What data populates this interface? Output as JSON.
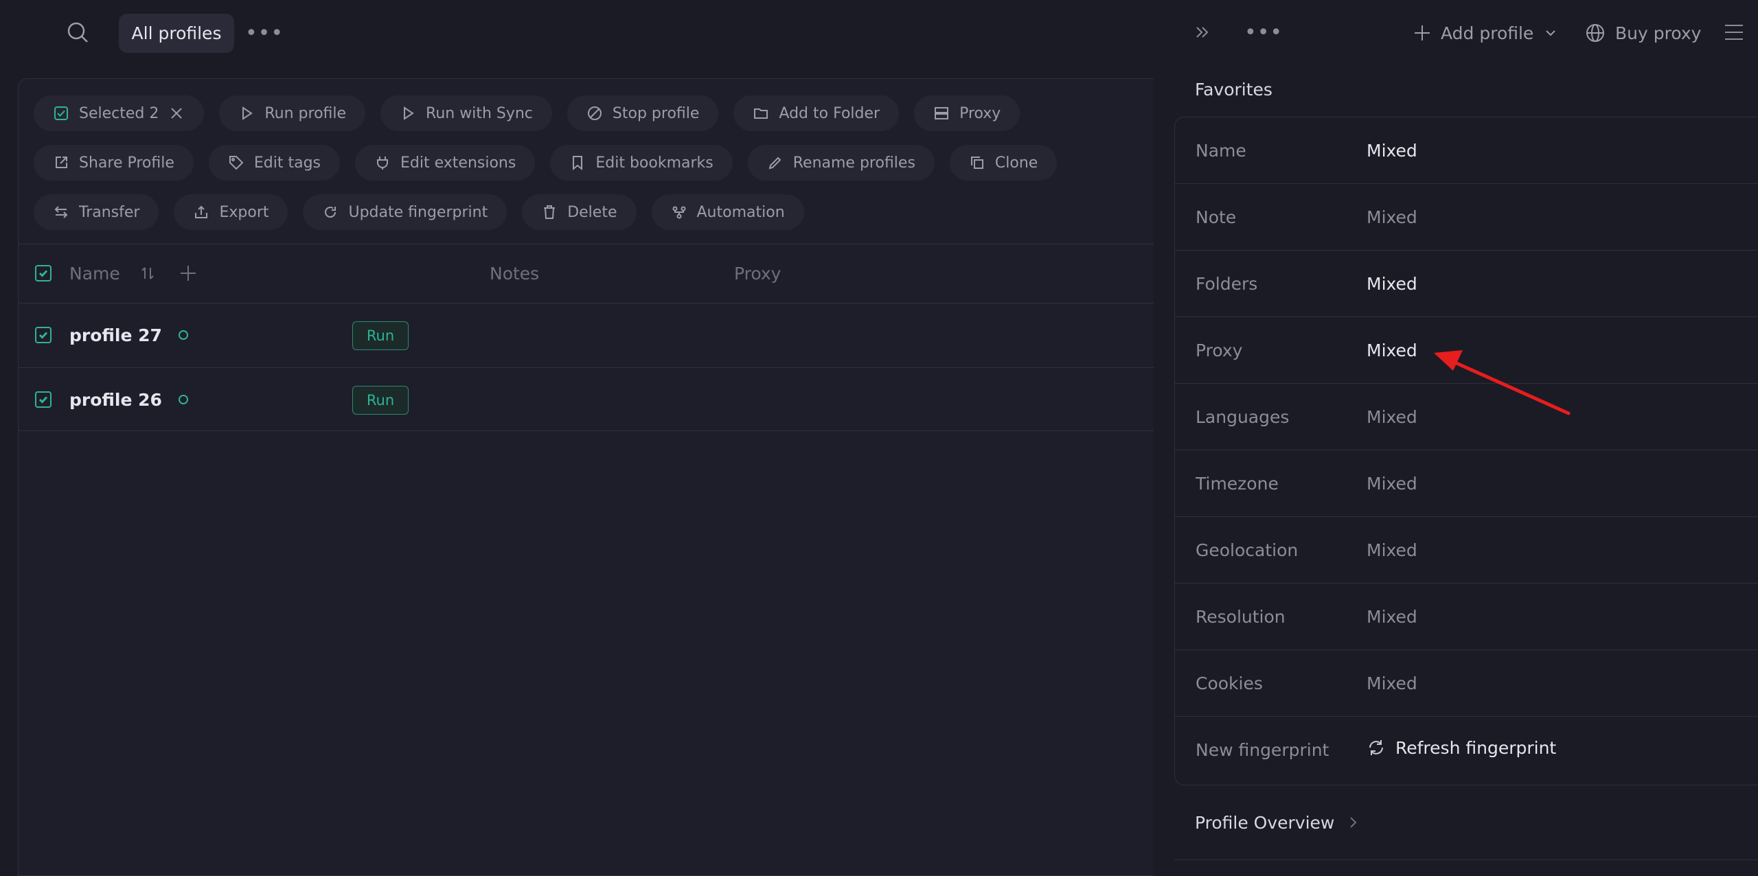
{
  "topbar": {
    "search_icon": "search-icon",
    "tab_all_profiles": "All profiles",
    "more_icon": "ellipsis-icon"
  },
  "toolbar": {
    "row1": [
      {
        "label": "Selected 2",
        "icon": "checkbox-icon"
      },
      {
        "label": "Run profile",
        "icon": "play-icon"
      },
      {
        "label": "Run with Sync",
        "icon": "play-icon"
      },
      {
        "label": "Stop profile",
        "icon": "stop-icon"
      },
      {
        "label": "Add to Folder",
        "icon": "folder-icon"
      },
      {
        "label": "Proxy",
        "icon": "server-icon"
      }
    ],
    "row2": [
      {
        "label": "Share Profile",
        "icon": "share-icon"
      },
      {
        "label": "Edit tags",
        "icon": "tag-icon"
      },
      {
        "label": "Edit extensions",
        "icon": "plug-icon"
      },
      {
        "label": "Edit bookmarks",
        "icon": "bookmark-icon"
      },
      {
        "label": "Rename profiles",
        "icon": "pencil-icon"
      },
      {
        "label": "Clone",
        "icon": "copy-icon"
      }
    ],
    "row3": [
      {
        "label": "Transfer",
        "icon": "transfer-icon"
      },
      {
        "label": "Export",
        "icon": "export-icon"
      },
      {
        "label": "Update fingerprint",
        "icon": "refresh-icon"
      },
      {
        "label": "Delete",
        "icon": "trash-icon"
      },
      {
        "label": "Automation",
        "icon": "automation-icon"
      }
    ]
  },
  "table": {
    "headers": {
      "name": "Name",
      "notes": "Notes",
      "proxy": "Proxy"
    },
    "rows": [
      {
        "name": "profile 27",
        "action": "Run"
      },
      {
        "name": "profile 26",
        "action": "Run"
      }
    ]
  },
  "right_panel": {
    "add_profile": "Add profile",
    "buy_proxy": "Buy proxy",
    "favorites_title": "Favorites",
    "fields": [
      {
        "key": "Name",
        "value": "Mixed"
      },
      {
        "key": "Note",
        "value": "Mixed"
      },
      {
        "key": "Folders",
        "value": "Mixed"
      },
      {
        "key": "Proxy",
        "value": "Mixed"
      },
      {
        "key": "Languages",
        "value": "Mixed"
      },
      {
        "key": "Timezone",
        "value": "Mixed"
      },
      {
        "key": "Geolocation",
        "value": "Mixed"
      },
      {
        "key": "Resolution",
        "value": "Mixed"
      },
      {
        "key": "Cookies",
        "value": "Mixed"
      },
      {
        "key": "New fingerprint",
        "value": "Refresh fingerprint"
      }
    ],
    "profile_overview": "Profile Overview"
  },
  "colors": {
    "accent": "#2fb394",
    "annotation_arrow": "#e81d1d"
  }
}
